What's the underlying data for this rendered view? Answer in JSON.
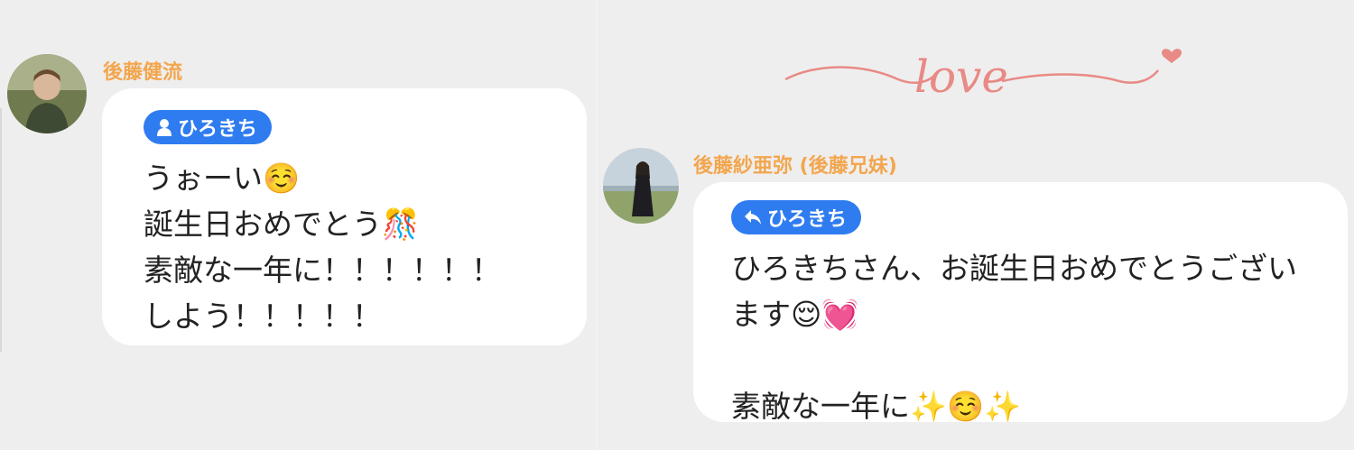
{
  "messages": [
    {
      "sender": "後藤健流",
      "mention": "ひろきち",
      "mention_icon": "person-icon",
      "lines": [
        "うぉーい☺️",
        "誕生日おめでとう🎊",
        "素敵な一年に！！！！！！",
        "しよう！！！！！"
      ]
    },
    {
      "sender": "後藤紗亜弥 (後藤兄妹)",
      "mention": "ひろきち",
      "mention_icon": "reply-arrow-icon",
      "lines": [
        "ひろきちさん、お誕生日おめでとうござい",
        "ます😌💓",
        "",
        "素敵な一年に✨☺️✨"
      ]
    }
  ],
  "decoration": {
    "text": "love",
    "color": "#e88a86"
  },
  "colors": {
    "sender": "#f2a64e",
    "mention": "#2f7cf0",
    "background": "#efeeee"
  }
}
